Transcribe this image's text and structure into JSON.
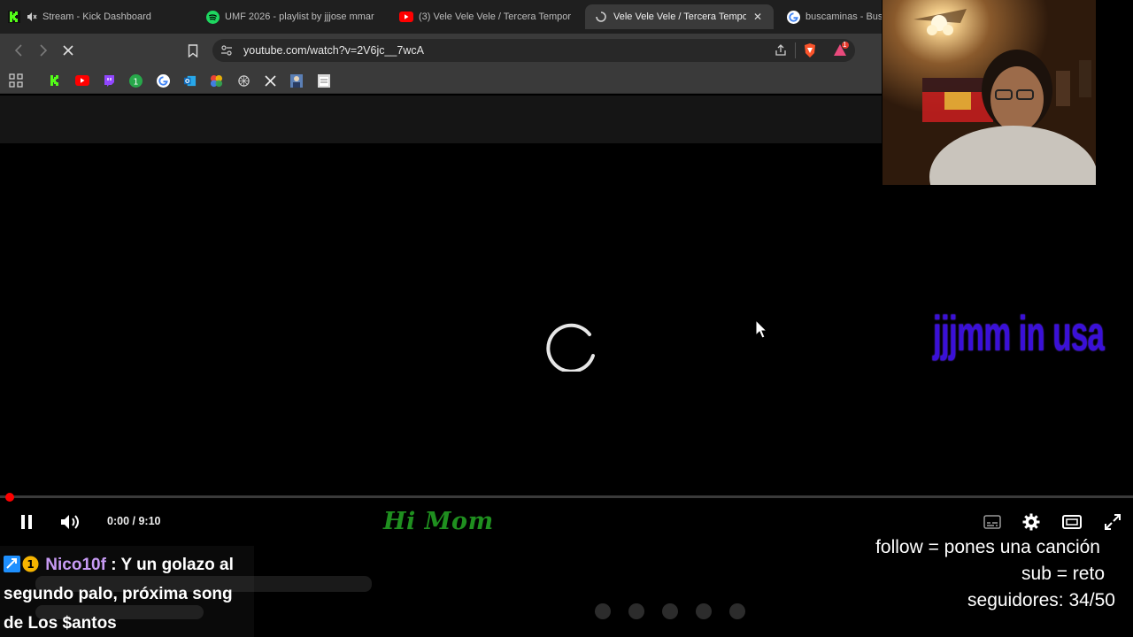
{
  "browser": {
    "tabs": [
      {
        "title": "Stream - Kick Dashboard",
        "icon": "kick-icon"
      },
      {
        "title": "UMF 2026 - playlist by jjjose mmar",
        "icon": "spotify-icon"
      },
      {
        "title": "(3) Vele Vele Vele / Tercera Tempor",
        "icon": "youtube-icon"
      },
      {
        "title": "Vele Vele Vele / Tercera Tempo",
        "icon": "loading-icon",
        "active": true
      },
      {
        "title": "buscaminas - Bus",
        "icon": "google-icon"
      }
    ],
    "url": "youtube.com/watch?v=2V6jc__7wcA",
    "shield_count": "1"
  },
  "player": {
    "time_current": "0:00",
    "time_separator": " / ",
    "time_total": "9:10",
    "progress": 0,
    "loading": true
  },
  "overlay": {
    "brand_text": "jjjmm in usa",
    "hi_mom": "Hi Mom",
    "chat": {
      "username": "Nico10f",
      "separator": " : ",
      "message": "Y un golazo al segundo palo, próxima song de Los $antos"
    },
    "follow_line": "follow = pones una canción",
    "sub_line": "sub = reto",
    "followers_label": "seguidores:",
    "followers_value": "34/50"
  },
  "colors": {
    "progress_red": "#ff0000",
    "brand_purple": "#3a10d8",
    "himom_green": "#1f8f1f",
    "chat_username": "#c89bf5"
  }
}
